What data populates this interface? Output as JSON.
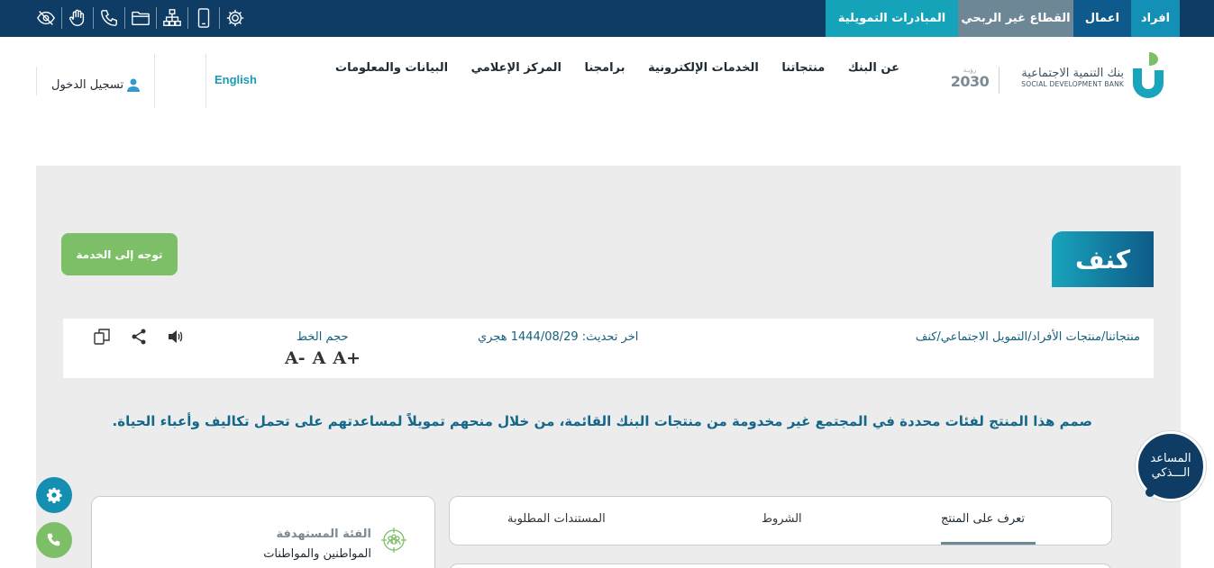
{
  "topbar": {
    "tabs": [
      "افراد",
      "اعمال",
      "القطاع غير الربحي",
      "المبادرات التمويلية"
    ],
    "icons": [
      "eye-slash-icon",
      "sign-language-icon",
      "phone-icon",
      "folder-icon",
      "sitemap-icon",
      "mobile-icon",
      "settings-icon"
    ]
  },
  "header": {
    "bank_name_ar": "بنك التنمية الاجتماعية",
    "bank_name_en": "SOCIAL DEVELOPMENT BANK",
    "vision_top": "رؤيـة",
    "vision_number": "2030",
    "nav": [
      "عن البنك",
      "منتجاتنا",
      "الخدمات الإلكترونية",
      "برامجنا",
      "المركز الإعلامي",
      "البيانات والمعلومات"
    ],
    "language": "English",
    "login": "تسجيل الدخول"
  },
  "product": {
    "title": "كنف",
    "service_button": "توجه إلى الخدمة",
    "breadcrumb": [
      "منتجاتنا",
      "/",
      "منتجات الأفراد",
      "/",
      "التمويل الاجتماعي",
      "/",
      "كنف"
    ],
    "last_updated": "اخر تحديث: 1444/08/29 هجري",
    "font_size_label": "حجم الخط",
    "font_controls": [
      "A+",
      "A",
      "A-"
    ],
    "description": "صمم هذا المنتج لفئات محددة في المجتمع غير مخدومة من منتجات البنك القائمة، من خلال منحهم تمويلاً لمساعدتهم على تحمل تكاليف وأعباء الحياة."
  },
  "tabs": [
    "تعرف على المنتج",
    "الشروط",
    "المستندات المطلوبة"
  ],
  "target": {
    "title": "الفئة المستهدفة",
    "value": "المواطنين والمواطنات"
  },
  "assistant": {
    "line1": "المساعد",
    "line2": "الـــذكي"
  },
  "colors": {
    "topbar": "#0e3c64",
    "accent": "#1390b5",
    "green": "#7cbf66",
    "panel": "#ececec",
    "text_blue": "#15678a"
  }
}
